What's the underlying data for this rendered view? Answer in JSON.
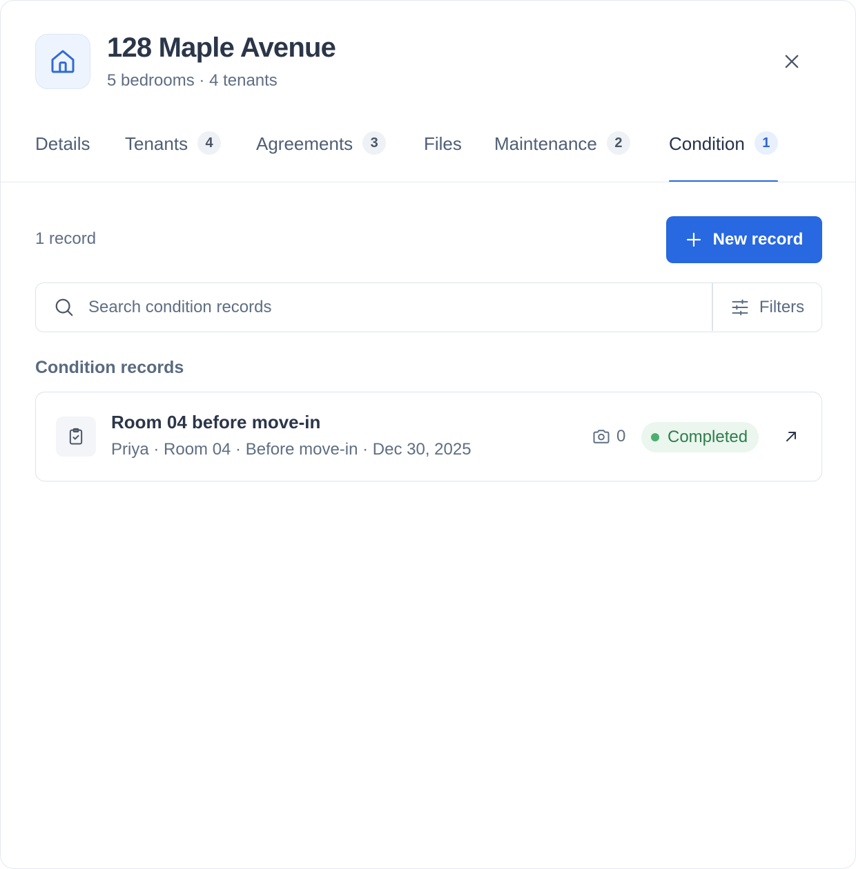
{
  "property": {
    "title": "128 Maple Avenue",
    "subtitle": "5 bedrooms · 4 tenants"
  },
  "tabs": [
    {
      "label": "Details",
      "count": null
    },
    {
      "label": "Tenants",
      "count": "4"
    },
    {
      "label": "Agreements",
      "count": "3"
    },
    {
      "label": "Files",
      "count": null
    },
    {
      "label": "Maintenance",
      "count": "2"
    },
    {
      "label": "Condition",
      "count": "1",
      "active": true
    }
  ],
  "toolbar": {
    "record_count": "1 record",
    "new_record_label": "New record"
  },
  "search": {
    "placeholder": "Search condition records",
    "filters_label": "Filters"
  },
  "section": {
    "title": "Condition records"
  },
  "records": [
    {
      "title": "Room 04 before move-in",
      "meta": "Priya · Room 04 · Before move-in · Dec 30, 2025",
      "photos": "0",
      "status": "Completed"
    }
  ],
  "colors": {
    "accent": "#2868e0",
    "status_completed": "#4caf70"
  },
  "icons": {
    "header": "house-icon",
    "close": "close-icon",
    "new": "plus-icon",
    "search": "search-icon",
    "filters": "sliders-icon",
    "record": "clipboard-check-icon",
    "photos": "camera-icon",
    "open": "arrow-up-right-icon"
  }
}
